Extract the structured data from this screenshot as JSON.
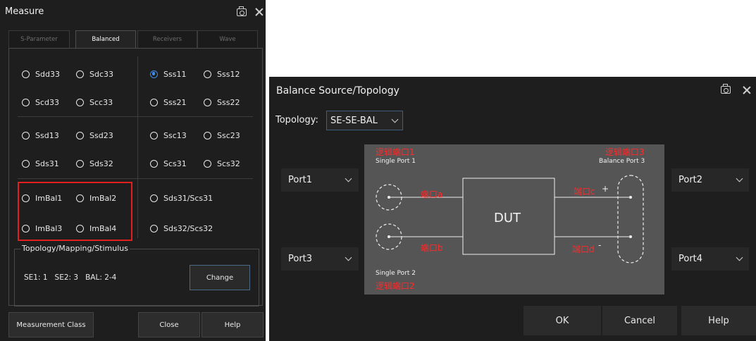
{
  "measure": {
    "title": "Measure",
    "tabs": [
      "S-Parameter",
      "Balanced",
      "Receivers",
      "Wave"
    ],
    "active_tab": "Balanced",
    "radios": [
      {
        "label": "Sdd33",
        "checked": false
      },
      {
        "label": "Sdc33",
        "checked": false
      },
      {
        "label": "Sss11",
        "checked": true
      },
      {
        "label": "Sss12",
        "checked": false
      },
      {
        "label": "Scd33",
        "checked": false
      },
      {
        "label": "Scc33",
        "checked": false
      },
      {
        "label": "Sss21",
        "checked": false
      },
      {
        "label": "Sss22",
        "checked": false
      },
      {
        "label": "Ssd13",
        "checked": false
      },
      {
        "label": "Ssd23",
        "checked": false
      },
      {
        "label": "Ssc13",
        "checked": false
      },
      {
        "label": "Ssc23",
        "checked": false
      },
      {
        "label": "Sds31",
        "checked": false
      },
      {
        "label": "Sds32",
        "checked": false
      },
      {
        "label": "Scs31",
        "checked": false
      },
      {
        "label": "Scs32",
        "checked": false
      },
      {
        "label": "ImBal1",
        "checked": false
      },
      {
        "label": "ImBal2",
        "checked": false
      },
      {
        "label": "Sds31/Scs31",
        "checked": false
      },
      {
        "label": "ImBal3",
        "checked": false
      },
      {
        "label": "ImBal4",
        "checked": false
      },
      {
        "label": "Sds32/Scs32",
        "checked": false
      }
    ],
    "group_label": "Topology/Mapping/Stimulus",
    "group_value": "SE1: 1   SE2: 3   BAL: 2-4",
    "change_label": "Change",
    "footer_buttons": [
      "Measurement Class",
      "Close",
      "Help"
    ],
    "highlight_color": "#e02020",
    "accent_color": "#3d8ee8"
  },
  "balance": {
    "title": "Balance Source/Topology",
    "topology_label": "Topology:",
    "topology_value": "SE-SE-BAL",
    "ports": {
      "left_top": "Port1",
      "left_bottom": "Port3",
      "right_top": "Port2",
      "right_bottom": "Port4"
    },
    "diagram": {
      "logic_port1": "逻辑端口1",
      "single_port1": "Single Port 1",
      "logic_port3": "逻辑端口3",
      "balance_port3": "Balance Port 3",
      "port_a": "端口a",
      "port_b": "端口b",
      "port_c": "端口c",
      "port_d": "端口d",
      "plus": "+",
      "minus": "-",
      "dut": "DUT",
      "single_port2": "Single Port 2",
      "logic_port2": "逻辑端口2"
    },
    "buttons": [
      "OK",
      "Cancel",
      "Help"
    ]
  }
}
